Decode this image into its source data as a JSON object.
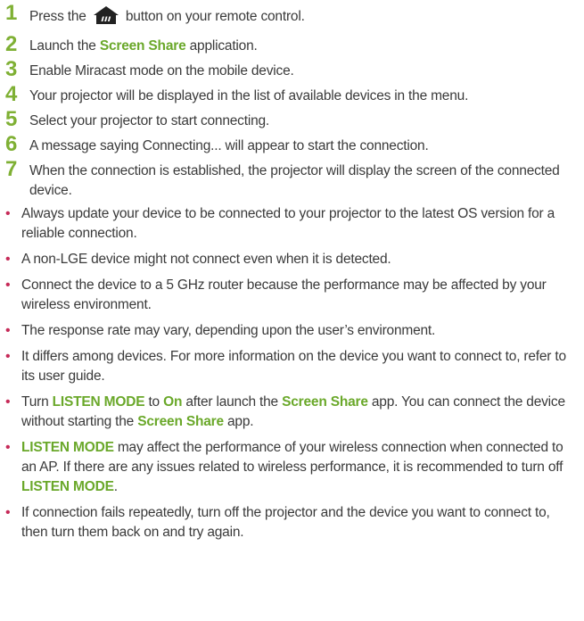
{
  "steps": [
    {
      "num": "1",
      "parts": [
        {
          "t": "Press the ",
          "hl": false
        },
        {
          "icon": "home-icon"
        },
        {
          "t": " button on your remote control.",
          "hl": false
        }
      ]
    },
    {
      "num": "2",
      "parts": [
        {
          "t": "Launch the ",
          "hl": false
        },
        {
          "t": "Screen Share",
          "hl": true
        },
        {
          "t": " application.",
          "hl": false
        }
      ]
    },
    {
      "num": "3",
      "parts": [
        {
          "t": "Enable Miracast mode on the mobile device.",
          "hl": false
        }
      ]
    },
    {
      "num": "4",
      "parts": [
        {
          "t": "Your projector will be displayed in the list of available devices in the menu.",
          "hl": false
        }
      ]
    },
    {
      "num": "5",
      "parts": [
        {
          "t": "Select your projector to start connecting.",
          "hl": false
        }
      ]
    },
    {
      "num": "6",
      "parts": [
        {
          "t": "A message saying Connecting... will appear to start the connection.",
          "hl": false
        }
      ]
    },
    {
      "num": "7",
      "parts": [
        {
          "t": "When the connection is established, the projector will display the screen of the connected device.",
          "hl": false
        }
      ]
    }
  ],
  "bullets": [
    {
      "parts": [
        {
          "t": "Always update your device to be connected to your projector to the latest OS version for a reliable connection.",
          "hl": false
        }
      ]
    },
    {
      "parts": [
        {
          "t": "A non-LGE device might not connect even when it is detected.",
          "hl": false
        }
      ]
    },
    {
      "parts": [
        {
          "t": "Connect the device to a 5 GHz router because the performance may be affected by your wireless environment.",
          "hl": false
        }
      ]
    },
    {
      "parts": [
        {
          "t": "The response rate may vary, depending upon the user’s environment.",
          "hl": false
        }
      ]
    },
    {
      "parts": [
        {
          "t": "It differs among devices. For more information on the device you want to connect to, refer to its user guide.",
          "hl": false
        }
      ]
    },
    {
      "parts": [
        {
          "t": "Turn ",
          "hl": false
        },
        {
          "t": "LISTEN MODE",
          "hl": true
        },
        {
          "t": " to ",
          "hl": false
        },
        {
          "t": "On",
          "hl": true
        },
        {
          "t": " after launch the ",
          "hl": false
        },
        {
          "t": "Screen Share",
          "hl": true
        },
        {
          "t": " app. You can connect the device without starting the ",
          "hl": false
        },
        {
          "t": "Screen Share",
          "hl": true
        },
        {
          "t": " app.",
          "hl": false
        }
      ]
    },
    {
      "parts": [
        {
          "t": "LISTEN MODE",
          "hl": true
        },
        {
          "t": " may affect the performance of your wireless connection when connected to an AP. If there are any issues related to wireless performance, it is recommended to turn off ",
          "hl": false
        },
        {
          "t": "LISTEN MODE",
          "hl": true
        },
        {
          "t": ".",
          "hl": false
        }
      ]
    },
    {
      "parts": [
        {
          "t": "If connection fails repeatedly, turn off the projector and the device you want to connect to, then turn them back on and try again.",
          "hl": false
        }
      ]
    }
  ],
  "bullet_glyph": "•",
  "colors": {
    "step_number": "#7fb034",
    "highlight": "#6aa82a",
    "bullet": "#c62a58",
    "text": "#3a3a3a",
    "icon": "#222222"
  }
}
